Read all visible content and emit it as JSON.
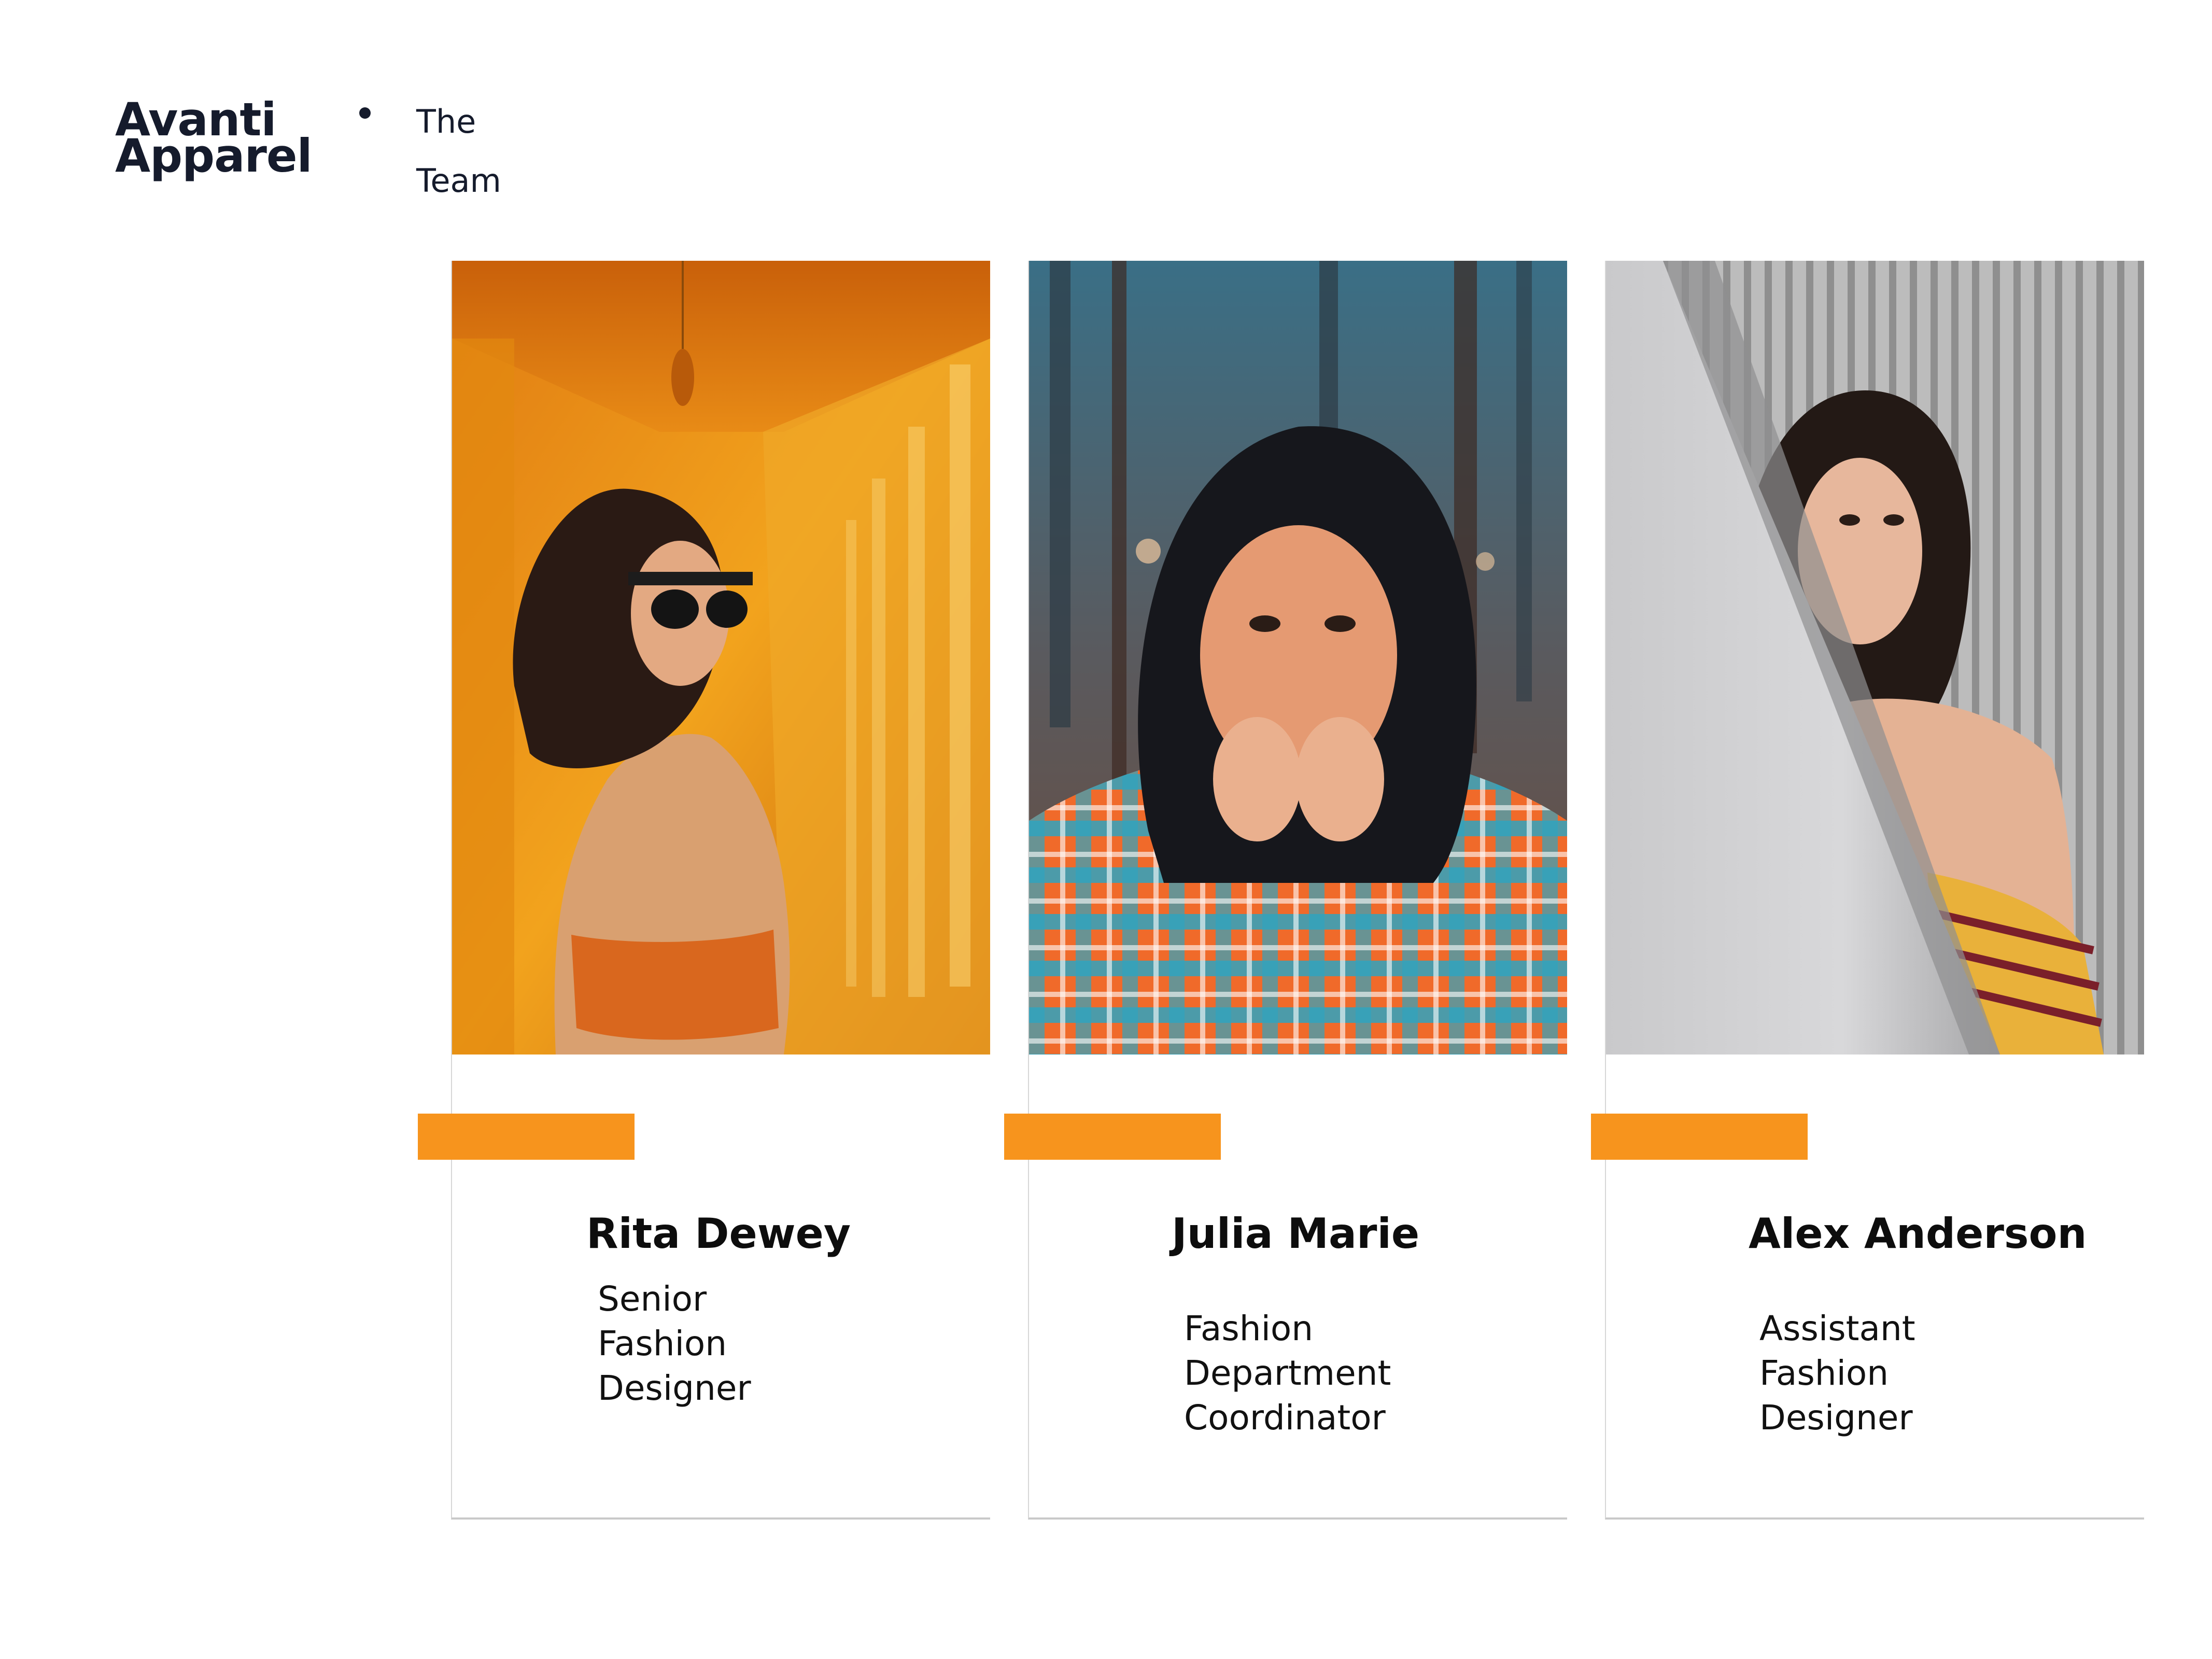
{
  "brand": {
    "line1": "Avanti",
    "line2": "Apparel"
  },
  "section": {
    "line1": "The",
    "line2": "Team"
  },
  "colors": {
    "accent": "#f7941d",
    "text": "#151b2c"
  },
  "team": [
    {
      "name": "Rita Dewey",
      "role_lines": [
        "Senior",
        "Fashion",
        "Designer"
      ],
      "photo": "woman-in-orange-hallway-photo"
    },
    {
      "name": "Julia Marie",
      "role_lines": [
        "Fashion",
        "Department",
        "Coordinator"
      ],
      "photo": "woman-in-plaid-shirt-photo"
    },
    {
      "name": "Alex Anderson",
      "role_lines": [
        "Assistant",
        "Fashion",
        "Designer"
      ],
      "photo": "woman-behind-grey-panel-photo"
    }
  ]
}
